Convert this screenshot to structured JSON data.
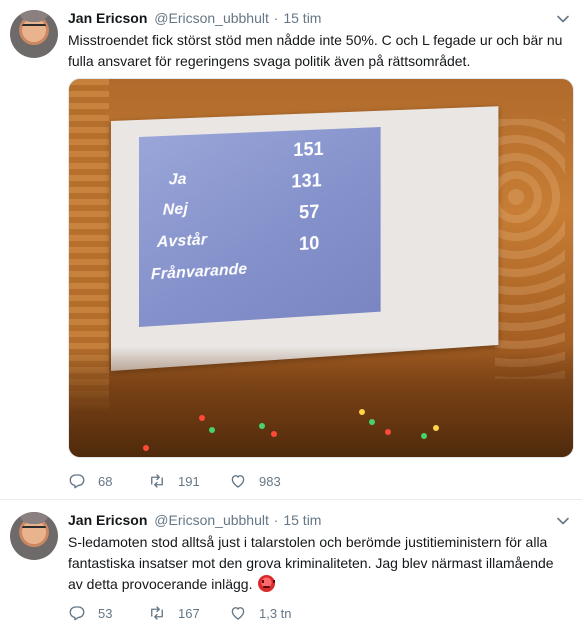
{
  "tweets": [
    {
      "author_name": "Jan Ericson",
      "handle": "@Ericson_ubbhult",
      "separator": "·",
      "time": "15 tim",
      "text": "Misstroendet fick störst stöd men nådde inte 50%. C och L fegade ur och bär nu fulla ansvaret för regeringens svaga politik även på rättsområdet.",
      "photo": {
        "votes": [
          {
            "label": "Ja",
            "value": "151"
          },
          {
            "label": "Nej",
            "value": "131"
          },
          {
            "label": "Avstår",
            "value": "57"
          },
          {
            "label": "Frånvarande",
            "value": "10"
          }
        ]
      },
      "replies": "68",
      "retweets": "191",
      "likes": "983"
    },
    {
      "author_name": "Jan Ericson",
      "handle": "@Ericson_ubbhult",
      "separator": "·",
      "time": "15 tim",
      "text": "S-ledamoten stod alltså just i talarstolen och berömde justitieministern för alla fantastiska insatser mot den grova kriminaliteten. Jag blev närmast illamående av detta provocerande inlägg.",
      "emoji": "angry-face",
      "replies": "53",
      "retweets": "167",
      "likes": "1,3 tn"
    }
  ],
  "colors": {
    "text": "#14171a",
    "muted": "#657786",
    "divider": "#e6ecf0"
  }
}
